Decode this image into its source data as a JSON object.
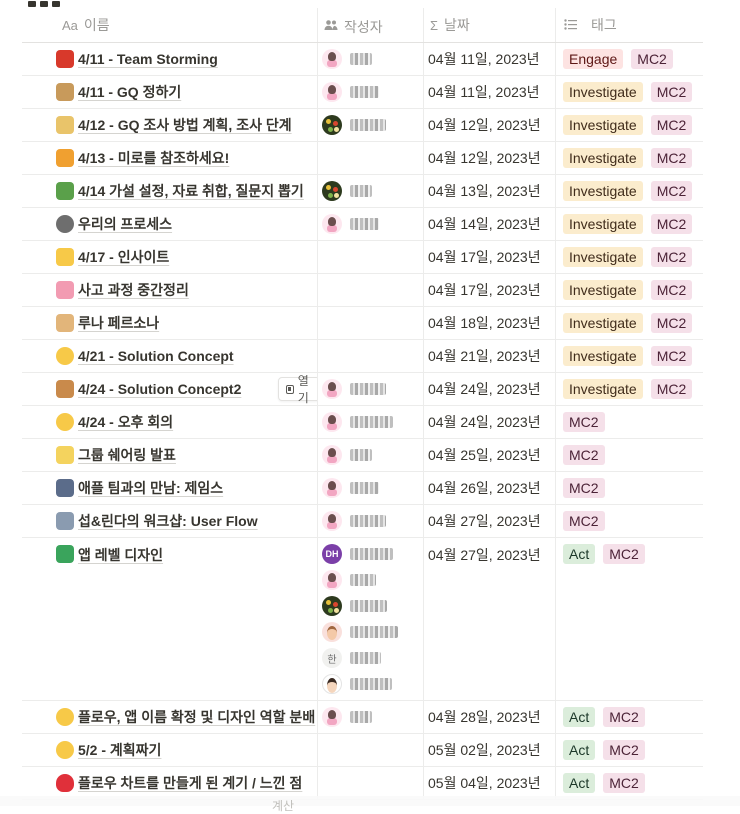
{
  "columns": {
    "name": {
      "icon": "Aa",
      "label": "이름"
    },
    "author": {
      "icon": "people-icon",
      "label": "작성자"
    },
    "date": {
      "icon": "Σ",
      "label": "날짜"
    },
    "tags": {
      "icon": "list-icon",
      "label": "태그"
    }
  },
  "open_button_label": "열기",
  "footer_calc": "계산",
  "rows": [
    {
      "emoji": "fire-truck",
      "title": "4/11 - Team Storming",
      "date": "04월 11일, 2023년",
      "tags": [
        "Engage",
        "MC2"
      ],
      "authors": [
        "girl"
      ]
    },
    {
      "emoji": "box",
      "title": "4/11 - GQ 정하기",
      "date": "04월 11일, 2023년",
      "tags": [
        "Investigate",
        "MC2"
      ],
      "authors": [
        "girl"
      ]
    },
    {
      "emoji": "memo",
      "title": "4/12 - GQ 조사 방법 계획, 조사 단계",
      "date": "04월 12일, 2023년",
      "tags": [
        "Investigate",
        "MC2"
      ],
      "authors": [
        "flower"
      ]
    },
    {
      "emoji": "pencil",
      "title": "4/13 - 미로를 참조하세요!",
      "date": "04월 12일, 2023년",
      "tags": [
        "Investigate",
        "MC2"
      ],
      "authors": []
    },
    {
      "emoji": "bamboo",
      "title": "4/14 가설 설정, 자료 취합, 질문지 뽑기",
      "date": "04월 13일, 2023년",
      "tags": [
        "Investigate",
        "MC2"
      ],
      "authors": [
        "flower"
      ]
    },
    {
      "emoji": "rock",
      "title": "우리의 프로세스",
      "date": "04월 14일, 2023년",
      "tags": [
        "Investigate",
        "MC2"
      ],
      "authors": [
        "girl"
      ]
    },
    {
      "emoji": "sparkle",
      "title": "4/17 - 인사이트",
      "date": "04월 17일, 2023년",
      "tags": [
        "Investigate",
        "MC2"
      ],
      "authors": []
    },
    {
      "emoji": "brain",
      "title": "사고 과정 중간정리",
      "date": "04월 17일, 2023년",
      "tags": [
        "Investigate",
        "MC2"
      ],
      "authors": []
    },
    {
      "emoji": "person",
      "title": "루나 페르소나",
      "date": "04월 18일, 2023년",
      "tags": [
        "Investigate",
        "MC2"
      ],
      "authors": []
    },
    {
      "emoji": "smile",
      "title": "4/21 - Solution Concept",
      "date": "04월 21일, 2023년",
      "tags": [
        "Investigate",
        "MC2"
      ],
      "authors": []
    },
    {
      "emoji": "palette",
      "title": "4/24 - Solution Concept2",
      "date": "04월 24일, 2023년",
      "tags": [
        "Investigate",
        "MC2"
      ],
      "authors": [
        "girl"
      ],
      "hover": true
    },
    {
      "emoji": "sunglasses",
      "title": "4/24 - 오후 회의",
      "date": "04월 24일, 2023년",
      "tags": [
        "MC2"
      ],
      "authors": [
        "girl"
      ]
    },
    {
      "emoji": "bulb",
      "title": "그룹 쉐어링 발표",
      "date": "04월 25일, 2023년",
      "tags": [
        "MC2"
      ],
      "authors": [
        "girl"
      ]
    },
    {
      "emoji": "curling",
      "title": "애플 팀과의 만남: 제임스",
      "date": "04월 26일, 2023년",
      "tags": [
        "MC2"
      ],
      "authors": [
        "girl"
      ]
    },
    {
      "emoji": "van",
      "title": "섭&린다의 워크샵: User Flow",
      "date": "04월 27일, 2023년",
      "tags": [
        "MC2"
      ],
      "authors": [
        "girl"
      ]
    },
    {
      "emoji": "chart",
      "title": "앱 레벨 디자인",
      "date": "04월 27일, 2023년",
      "tags": [
        "Act",
        "MC2"
      ],
      "authors": [
        "dh",
        "girl",
        "flower",
        "cartoon",
        "han",
        "boy"
      ]
    },
    {
      "emoji": "heart-eyes",
      "title": "플로우, 앱 이름 확정 및 디자인 역할 분배",
      "date": "04월 28일, 2023년",
      "tags": [
        "Act",
        "MC2"
      ],
      "authors": [
        "girl"
      ]
    },
    {
      "emoji": "tongue",
      "title": "5/2 - 계획짜기",
      "date": "05월 02일, 2023년",
      "tags": [
        "Act",
        "MC2"
      ],
      "authors": []
    },
    {
      "emoji": "heart",
      "title": "플로우 차트를 만들게 된 계기 / 느낀 점",
      "date": "05월 04일, 2023년",
      "tags": [
        "Act",
        "MC2"
      ],
      "authors": []
    }
  ],
  "avatar_text": {
    "dh": "DH",
    "han": "한"
  },
  "colors": {
    "engage_bg": "#fde3e2",
    "investigate_bg": "#fbeccd",
    "mc2_bg": "#f5e0e9",
    "act_bg": "#dbeddb",
    "text": "#37352f",
    "muted": "#9b9a97",
    "border": "#ececeb"
  }
}
